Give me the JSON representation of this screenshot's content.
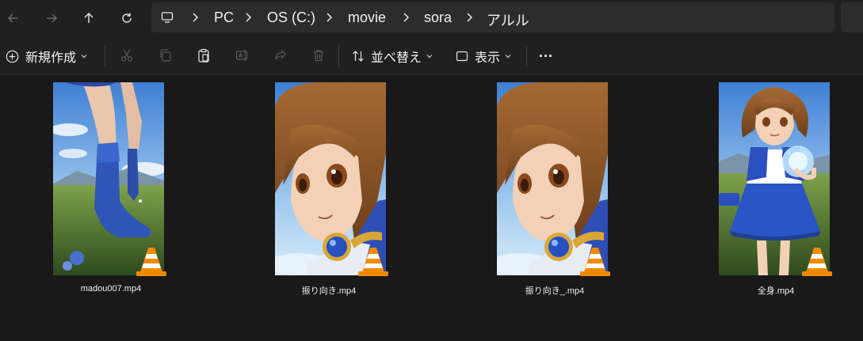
{
  "breadcrumb": [
    "PC",
    "OS (C:)",
    "movie",
    "sora",
    "アルル"
  ],
  "toolbar": {
    "new_label": "新規作成",
    "sort_label": "並べ替え",
    "view_label": "表示",
    "more_label": "···"
  },
  "files": [
    {
      "name": "madou007.mp4",
      "thumb": "legs-boots"
    },
    {
      "name": "振り向き.mp4",
      "thumb": "face-closeup"
    },
    {
      "name": "振り向き_.mp4",
      "thumb": "face-closeup"
    },
    {
      "name": "全身.mp4",
      "thumb": "full-body-orb"
    }
  ],
  "colors": {
    "accent_blue": "#2a4fae",
    "window_bg": "#191919",
    "toolbar_bg": "#202020",
    "vlc_orange": "#f08a00"
  }
}
